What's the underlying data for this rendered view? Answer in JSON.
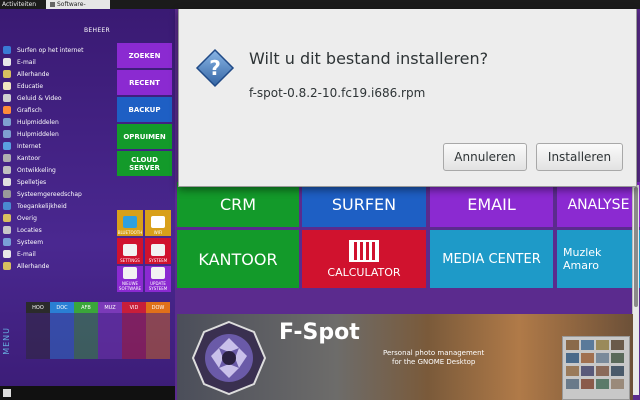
{
  "topbar": {
    "activities": "Activiteiten",
    "app_tab": "Software-installatie"
  },
  "left_panel": {
    "header": "BEHEER",
    "menu_items": [
      {
        "label": "Surfen op het internet",
        "color": "#3a7bd5"
      },
      {
        "label": "E-mail",
        "color": "#e8e8e8"
      },
      {
        "label": "Allerhande",
        "color": "#d8c060"
      },
      {
        "label": "Educatie",
        "color": "#f0e6c0"
      },
      {
        "label": "Geluid & Video",
        "color": "#d0d0d0"
      },
      {
        "label": "Grafisch",
        "color": "#ff8c3a"
      },
      {
        "label": "Hulpmiddelen",
        "color": "#7fa0d0"
      },
      {
        "label": "Hulpmiddelen",
        "color": "#7fa0d0"
      },
      {
        "label": "Internet",
        "color": "#5aa0e0"
      },
      {
        "label": "Kantoor",
        "color": "#b0b0b0"
      },
      {
        "label": "Ontwikkeling",
        "color": "#c0c0c0"
      },
      {
        "label": "Spelletjes",
        "color": "#e0e0e0"
      },
      {
        "label": "Systeemgereedschap",
        "color": "#9a9a9a"
      },
      {
        "label": "Toegankelijkheid",
        "color": "#4a8ad0"
      },
      {
        "label": "Overig",
        "color": "#d8c060"
      },
      {
        "label": "Locaties",
        "color": "#c8c8c8"
      },
      {
        "label": "Systeem",
        "color": "#7aa0d8"
      },
      {
        "label": "E-mail",
        "color": "#e8e8e8"
      },
      {
        "label": "Allerhande",
        "color": "#d8c060"
      }
    ],
    "tiles": [
      {
        "label": "ZOEKEN",
        "color": "#8b2ad1"
      },
      {
        "label": "RECENT",
        "color": "#8b2ad1"
      },
      {
        "label": "BACKUP",
        "color": "#1e5fc4"
      },
      {
        "label": "OPRUIMEN",
        "color": "#139a2a"
      },
      {
        "label": "CLOUD SERVER",
        "color": "#139a2a"
      }
    ],
    "small_tiles": [
      {
        "label": "BLUETOOTH",
        "color": "#d8a01a",
        "icon_color": "#2fa0e0"
      },
      {
        "label": "WIFI",
        "color": "#d8a01a",
        "icon_color": "#ffffff"
      },
      {
        "label": "SETTINGS",
        "color": "#d0122e",
        "icon_color": "#f2f2f2"
      },
      {
        "label": "SYSTEEM",
        "color": "#d0122e",
        "icon_color": "#f2f2f2"
      },
      {
        "label": "NIEUWE SOFTWARE",
        "color": "#8b2ad1",
        "icon_color": "#f2f2f2"
      },
      {
        "label": "UPDATE SYSTEEM",
        "color": "#8b2ad1",
        "icon_color": "#f2f2f2"
      }
    ],
    "tabs": [
      {
        "label": "HOO",
        "color": "#2b2b2b"
      },
      {
        "label": "DOC",
        "color": "#2a7fd4"
      },
      {
        "label": "AFB",
        "color": "#3aa63a"
      },
      {
        "label": "MUZ",
        "color": "#7b3ab8"
      },
      {
        "label": "VID",
        "color": "#c81e3a"
      },
      {
        "label": "DOW",
        "color": "#e0701a"
      }
    ],
    "vertical_label": "MENU"
  },
  "right_tiles": [
    {
      "label": "CRM",
      "color": "#139a2a"
    },
    {
      "label": "SURFEN",
      "color": "#1e5fc4"
    },
    {
      "label": "EMAIL",
      "color": "#8b2ad1"
    },
    {
      "label": "ANALYSE",
      "color": "#8b2ad1"
    },
    {
      "label": "KANTOOR",
      "color": "#139a2a"
    },
    {
      "label": "CALCULATOR",
      "color": "#d0122e"
    },
    {
      "label": "MEDIA CENTER",
      "color": "#1e9ac8"
    },
    {
      "label": "Muzlek Amaro",
      "color": "#1e9ac8"
    }
  ],
  "banner": {
    "title": "F-Spot",
    "subtitle_line1": "Personal photo management",
    "subtitle_line2": "for the GNOME Desktop"
  },
  "dialog": {
    "heading": "Wilt u dit bestand installeren?",
    "filename": "f-spot-0.8.2-10.fc19.i686.rpm",
    "cancel_label": "Annuleren",
    "install_label": "Installeren"
  }
}
